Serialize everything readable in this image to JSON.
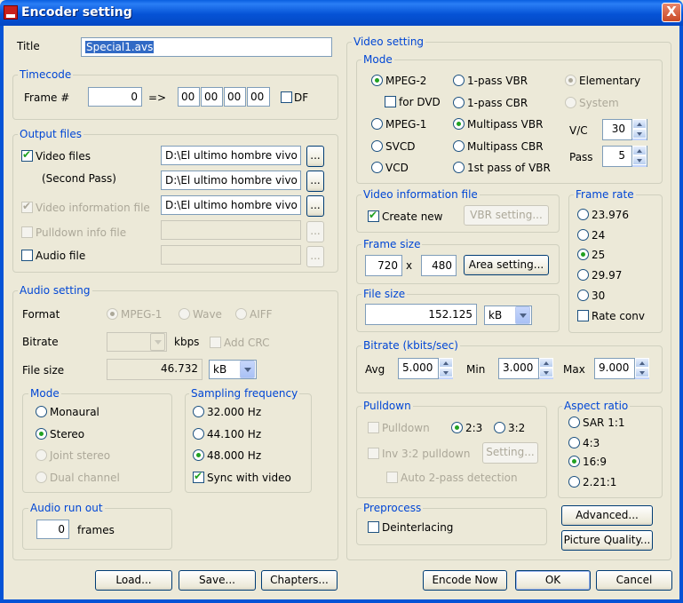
{
  "window": {
    "title": "Encoder setting",
    "close": "X"
  },
  "title_label": "Title",
  "title_value": "Special1.avs",
  "timecode": {
    "legend": "Timecode",
    "frame_label": "Frame #",
    "frame_value": "0",
    "arrow": "=>",
    "hh": "00",
    "mm": "00",
    "ss": "00",
    "ff": "00",
    "df_label": "DF"
  },
  "output": {
    "legend": "Output files",
    "video_files": "Video files",
    "second_pass": "(Second Pass)",
    "video_info": "Video information file",
    "pulldown_info": "Pulldown info file",
    "audio_file": "Audio file",
    "path1": "D:\\El ultimo hombre vivo V",
    "path2": "D:\\El ultimo hombre vivo V",
    "path3": "D:\\El ultimo hombre vivo V",
    "browse": "..."
  },
  "audio": {
    "legend": "Audio setting",
    "format_label": "Format",
    "formats": [
      "MPEG-1",
      "Wave",
      "AIFF"
    ],
    "bitrate_label": "Bitrate",
    "kbps": "kbps",
    "add_crc": "Add CRC",
    "filesize_label": "File size",
    "filesize_value": "46.732",
    "filesize_unit": "kB",
    "mode_legend": "Mode",
    "modes": [
      "Monaural",
      "Stereo",
      "Joint stereo",
      "Dual channel"
    ],
    "sampling_legend": "Sampling frequency",
    "rates": [
      "32.000 Hz",
      "44.100 Hz",
      "48.000 Hz"
    ],
    "sync": "Sync with video",
    "runout_legend": "Audio run out",
    "runout_value": "0",
    "frames": "frames"
  },
  "video": {
    "legend": "Video setting",
    "mode_legend": "Mode",
    "mpeg2": "MPEG-2",
    "for_dvd": "for DVD",
    "mpeg1": "MPEG-1",
    "svcd": "SVCD",
    "vcd": "VCD",
    "vbr1": "1-pass VBR",
    "cbr1": "1-pass CBR",
    "mvbr": "Multipass VBR",
    "mcbr": "Multipass CBR",
    "first_vbr": "1st pass of VBR",
    "elementary": "Elementary",
    "system": "System",
    "vc_label": "V/C",
    "vc_value": "30",
    "pass_label": "Pass",
    "pass_value": "5",
    "info_legend": "Video information file",
    "create_new": "Create new",
    "vbr_setting": "VBR setting...",
    "framesize_legend": "Frame size",
    "width": "720",
    "x": "x",
    "height": "480",
    "area_setting": "Area setting...",
    "filesize_legend": "File size",
    "filesize_value": "152.125",
    "filesize_unit": "kB",
    "framerate_legend": "Frame rate",
    "rates": [
      "23.976",
      "24",
      "25",
      "29.97",
      "30"
    ],
    "rate_conv": "Rate conv",
    "bitrate_legend": "Bitrate (kbits/sec)",
    "avg_label": "Avg",
    "avg_value": "5.000",
    "min_label": "Min",
    "min_value": "3.000",
    "max_label": "Max",
    "max_value": "9.000",
    "pulldown_legend": "Pulldown",
    "pulldown": "Pulldown",
    "p23": "2:3",
    "p32": "3:2",
    "inv": "Inv 3:2 pulldown",
    "setting": "Setting...",
    "auto2": "Auto 2-pass detection",
    "aspect_legend": "Aspect ratio",
    "aspects": [
      "SAR 1:1",
      "4:3",
      "16:9",
      "2.21:1"
    ],
    "preprocess_legend": "Preprocess",
    "deinterlacing": "Deinterlacing",
    "advanced": "Advanced...",
    "picture_quality": "Picture Quality..."
  },
  "buttons": {
    "load": "Load...",
    "save": "Save...",
    "chapters": "Chapters...",
    "encode_now": "Encode Now",
    "ok": "OK",
    "cancel": "Cancel"
  }
}
